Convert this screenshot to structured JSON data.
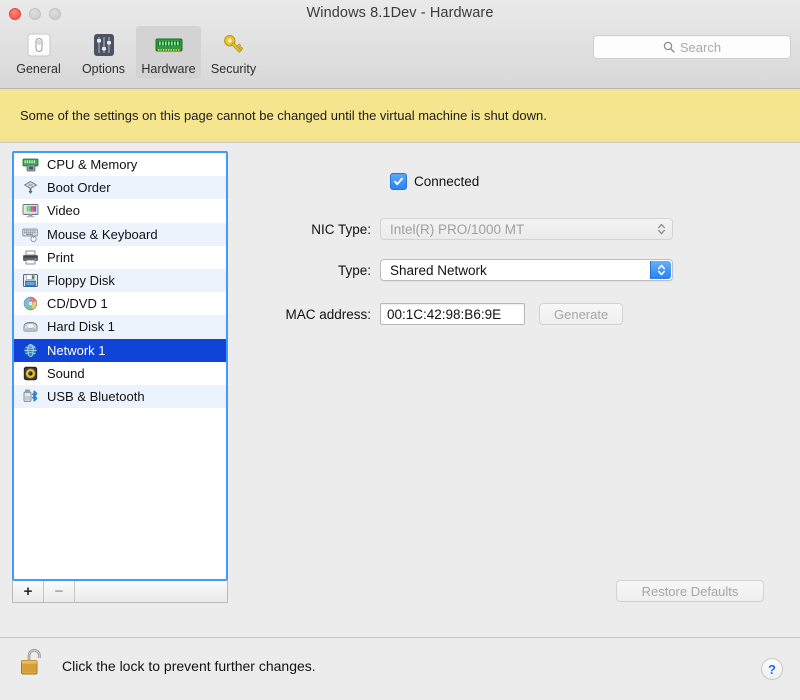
{
  "window": {
    "title": "Windows 8.1Dev - Hardware",
    "traffic_lights": [
      {
        "name": "close",
        "color": "#fc5b51",
        "enabled": true
      },
      {
        "name": "minimize",
        "color": "#d3d3d3",
        "enabled": false
      },
      {
        "name": "zoom",
        "color": "#d3d3d3",
        "enabled": false
      }
    ]
  },
  "toolbar": {
    "items": [
      {
        "label": "General",
        "icon": "toggle-switch-icon",
        "selected": false
      },
      {
        "label": "Options",
        "icon": "sliders-icon",
        "selected": false
      },
      {
        "label": "Hardware",
        "icon": "memory-stick-icon",
        "selected": true
      },
      {
        "label": "Security",
        "icon": "key-icon",
        "selected": false
      }
    ]
  },
  "search": {
    "placeholder": "Search",
    "value": "",
    "icon": "search-icon"
  },
  "banner": {
    "text": "Some of the settings on this page cannot be changed until the virtual machine is shut down.",
    "background": "#f6e58f"
  },
  "sidebar": {
    "selected_index": 8,
    "items": [
      {
        "label": "CPU & Memory",
        "icon": "cpu-memory-icon"
      },
      {
        "label": "Boot Order",
        "icon": "boot-order-icon"
      },
      {
        "label": "Video",
        "icon": "video-display-icon"
      },
      {
        "label": "Mouse & Keyboard",
        "icon": "keyboard-mouse-icon"
      },
      {
        "label": "Print",
        "icon": "printer-icon"
      },
      {
        "label": "Floppy Disk",
        "icon": "floppy-disk-icon"
      },
      {
        "label": "CD/DVD 1",
        "icon": "cd-dvd-icon"
      },
      {
        "label": "Hard Disk 1",
        "icon": "hard-disk-icon"
      },
      {
        "label": "Network 1",
        "icon": "network-globe-icon"
      },
      {
        "label": "Sound",
        "icon": "sound-speaker-icon"
      },
      {
        "label": "USB & Bluetooth",
        "icon": "usb-bluetooth-icon"
      }
    ],
    "footer": {
      "add_label": "+",
      "remove_label": "−",
      "add_enabled": true,
      "remove_enabled": false
    },
    "selection_color": "#1043d8",
    "focus_ring_color": "#3f9bff"
  },
  "panel": {
    "connected": {
      "label": "Connected",
      "checked": true,
      "accent": "#2d84f0"
    },
    "nic_type": {
      "label": "NIC Type:",
      "value": "Intel(R) PRO/1000 MT",
      "enabled": false
    },
    "type": {
      "label": "Type:",
      "value": "Shared Network",
      "enabled": true
    },
    "mac_address": {
      "label": "MAC address:",
      "value": "00:1C:42:98:B6:9E"
    },
    "generate_button": {
      "label": "Generate",
      "enabled": false
    },
    "restore_defaults_button": {
      "label": "Restore Defaults",
      "enabled": false
    }
  },
  "footer": {
    "lock_icon": "unlocked-padlock-icon",
    "lock_text": "Click the lock to prevent further changes.",
    "help_label": "?"
  }
}
